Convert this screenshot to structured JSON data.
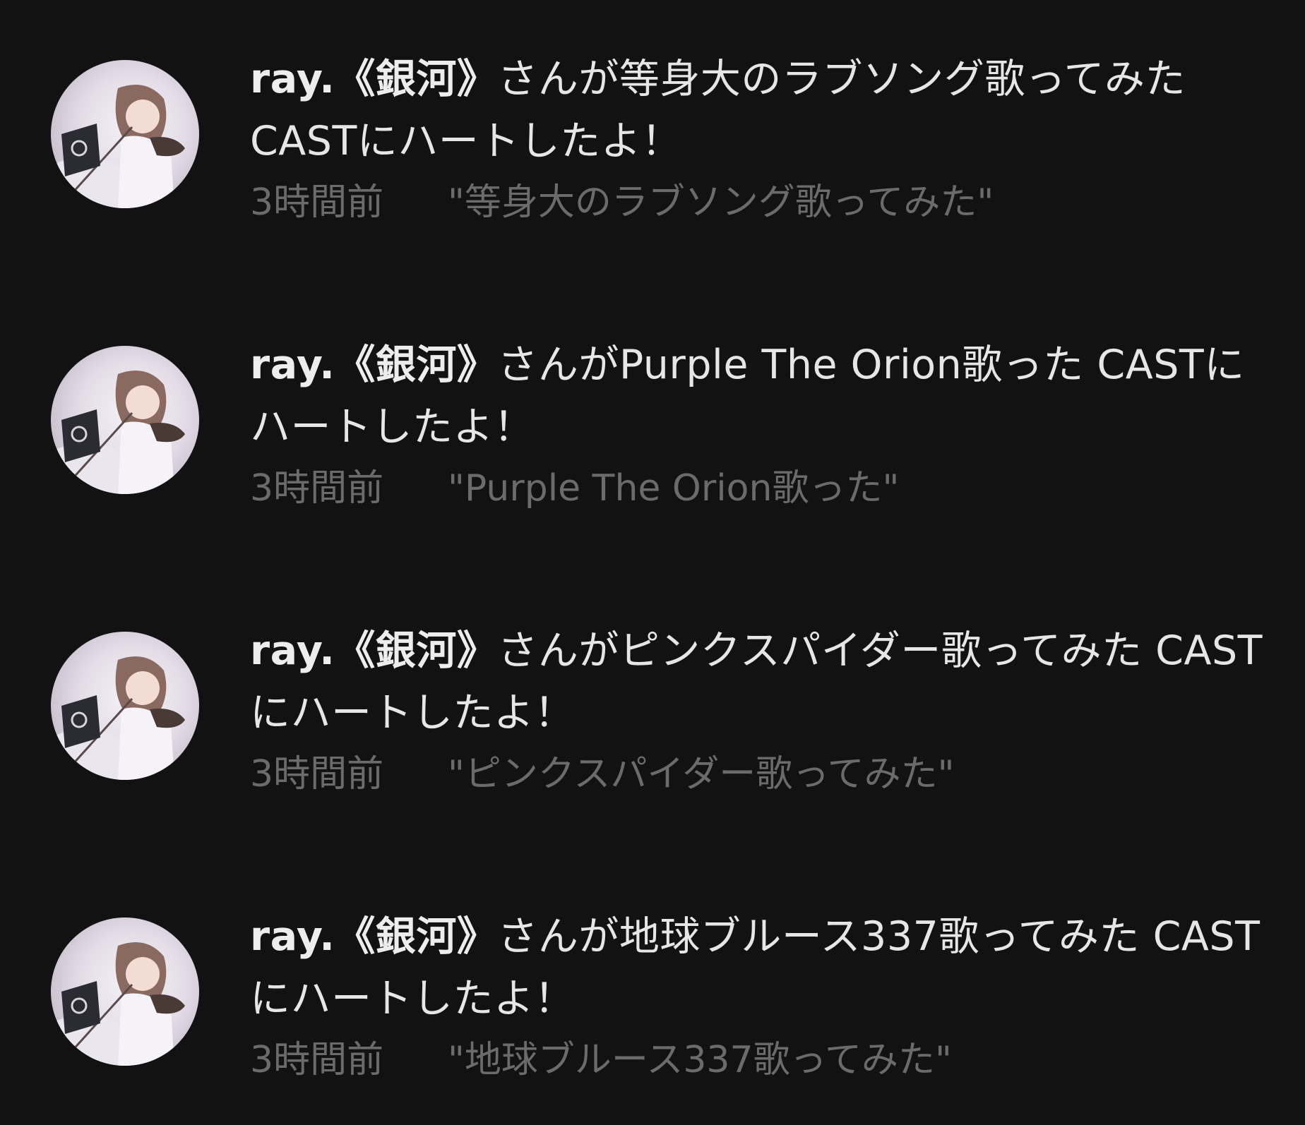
{
  "notifications": [
    {
      "user": "ray.《銀河》",
      "message": "さんが等身大のラブソング歌ってみた CASTにハートしたよ！",
      "time": "3時間前",
      "quote": "\"等身大のラブソング歌ってみた\"",
      "avatar_icon": "avatar-anime-girl-icon"
    },
    {
      "user": "ray.《銀河》",
      "message": "さんがPurple The Orion歌った CASTにハートしたよ！",
      "time": "3時間前",
      "quote": "\"Purple The Orion歌った\"",
      "avatar_icon": "avatar-anime-girl-icon"
    },
    {
      "user": "ray.《銀河》",
      "message": "さんがピンクスパイダー歌ってみた CASTにハートしたよ！",
      "time": "3時間前",
      "quote": "\"ピンクスパイダー歌ってみた\"",
      "avatar_icon": "avatar-anime-girl-icon"
    },
    {
      "user": "ray.《銀河》",
      "message": "さんが地球ブルース337歌ってみた CASTにハートしたよ！",
      "time": "3時間前",
      "quote": "\"地球ブルース337歌ってみた\"",
      "avatar_icon": "avatar-anime-girl-icon"
    }
  ],
  "colors": {
    "background": "#121212",
    "primary_text": "#e6e6e6",
    "secondary_text": "#6b6b6b"
  }
}
